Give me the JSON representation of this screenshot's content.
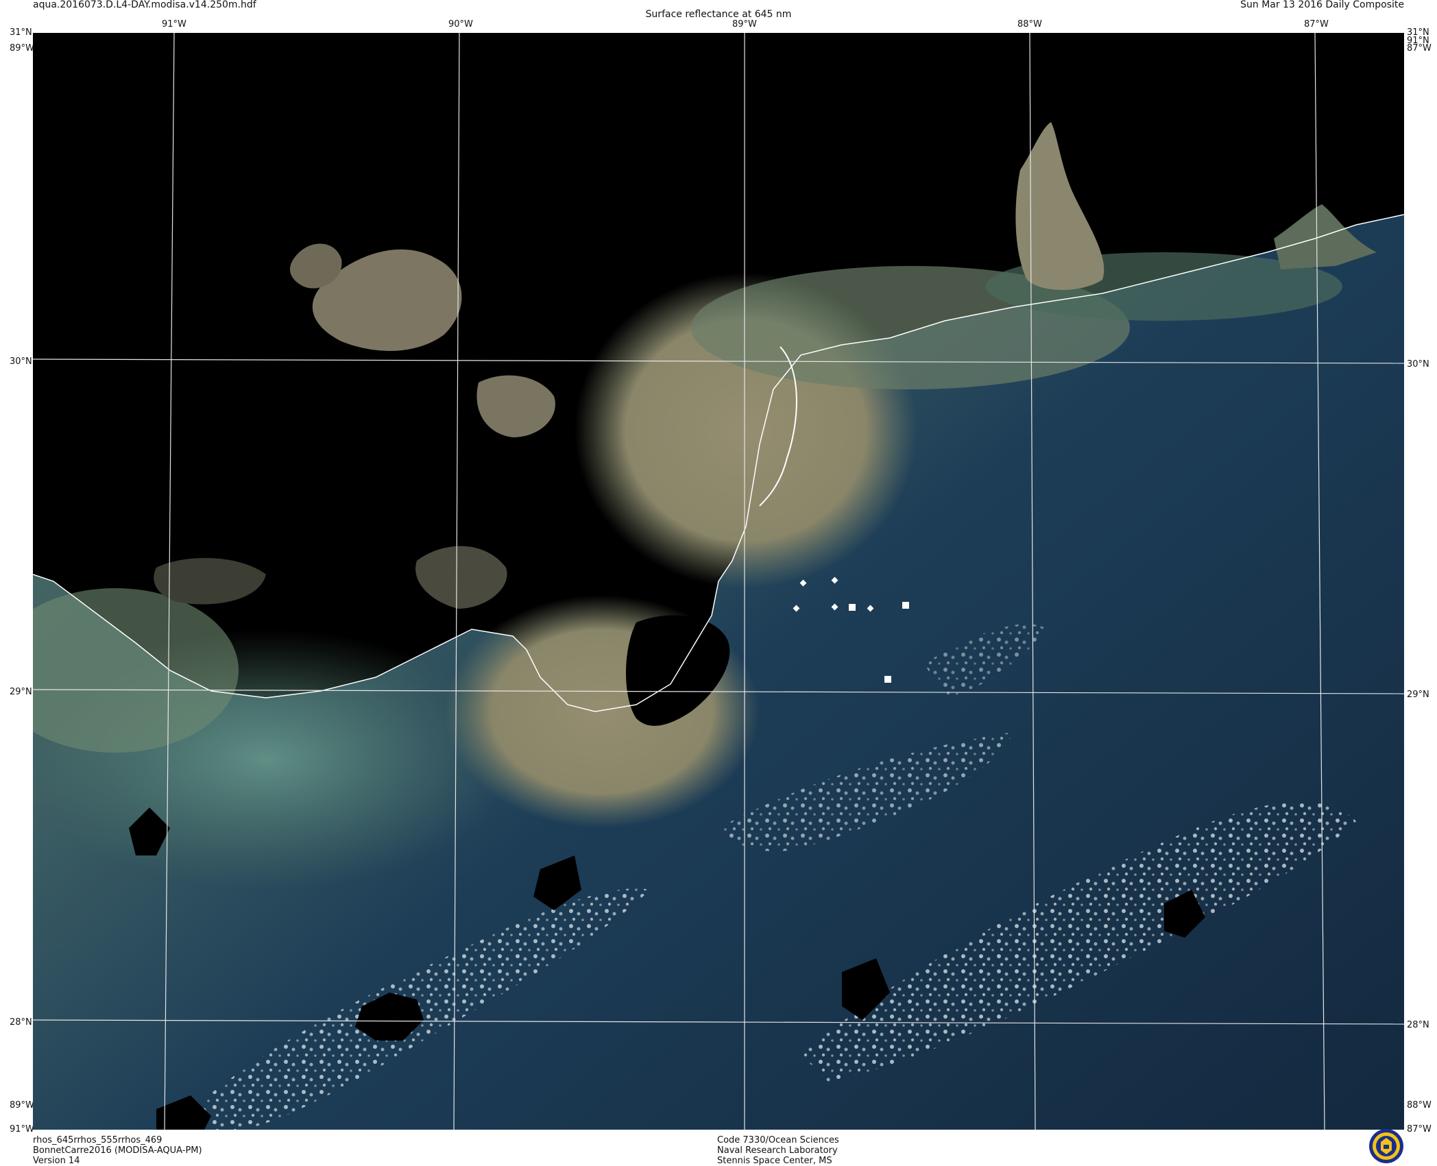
{
  "header": {
    "filename": "aqua.2016073.D.L4-DAY.modisa.v14.250m.hdf",
    "product_title": "Surface reflectance at 645 nm",
    "composite_date": "Sun Mar 13 2016 Daily Composite"
  },
  "map": {
    "longitude_labels_top": [
      "91°W",
      "90°W",
      "89°W",
      "88°W",
      "87°W"
    ],
    "latitude_labels": [
      "31°N",
      "30°N",
      "29°N",
      "28°N"
    ],
    "corner_labels": {
      "top_left_lat": "31°N",
      "top_left_lon": "89°W",
      "top_right_lat": "31°N",
      "top_right_lon": "87°W",
      "top_right_lat2": "91°N",
      "top_right_lon2": "89°W",
      "bottom_left_lon": "89°W",
      "bottom_left_lon2": "91°W",
      "bottom_right_lon": "88°W",
      "bottom_right_lon2": "87°W"
    },
    "colors": {
      "land": "#000000",
      "sediment_plume": "#8f8a6c",
      "turbid_green": "#4f7060",
      "open_ocean": "#1b3a55",
      "deep_ocean": "#13293f",
      "graticule": "#e6e6e6",
      "coastline": "#ffffff",
      "clouds": "#c8d4dc"
    }
  },
  "footer": {
    "bands": "rhos_645rrhos_555rrhos_469",
    "event": "BonnetCarre2016 (MODISA-AQUA-PM)",
    "version": "Version 14",
    "org_line1": "Code 7330/Ocean Sciences",
    "org_line2": "Naval Research Laboratory",
    "org_line3": "Stennis Space Center, MS"
  }
}
